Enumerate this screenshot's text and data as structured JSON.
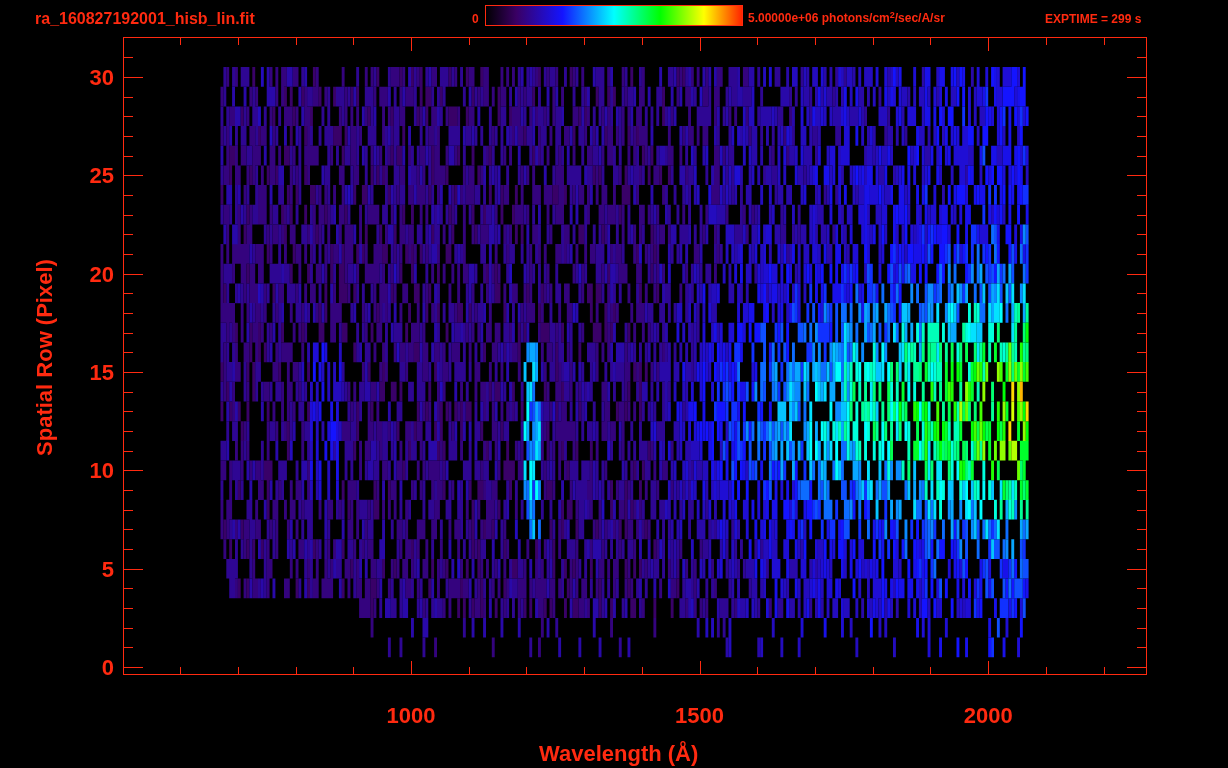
{
  "title": "ra_160827192001_hisb_lin.fit",
  "colorbar": {
    "min_label": "0",
    "max_label": "5.00000e+06 photons/cm$^{2}$/sec/A/sr"
  },
  "exposure": "EXPTIME = 299 s",
  "x_axis": {
    "label": "Wavelength (Å)",
    "ticks": [
      "1000",
      "1500",
      "2000"
    ]
  },
  "y_axis": {
    "label": "Spatial Row (Pixel)",
    "ticks": [
      "30",
      "25",
      "20",
      "15",
      "10",
      "5",
      "0"
    ]
  }
}
